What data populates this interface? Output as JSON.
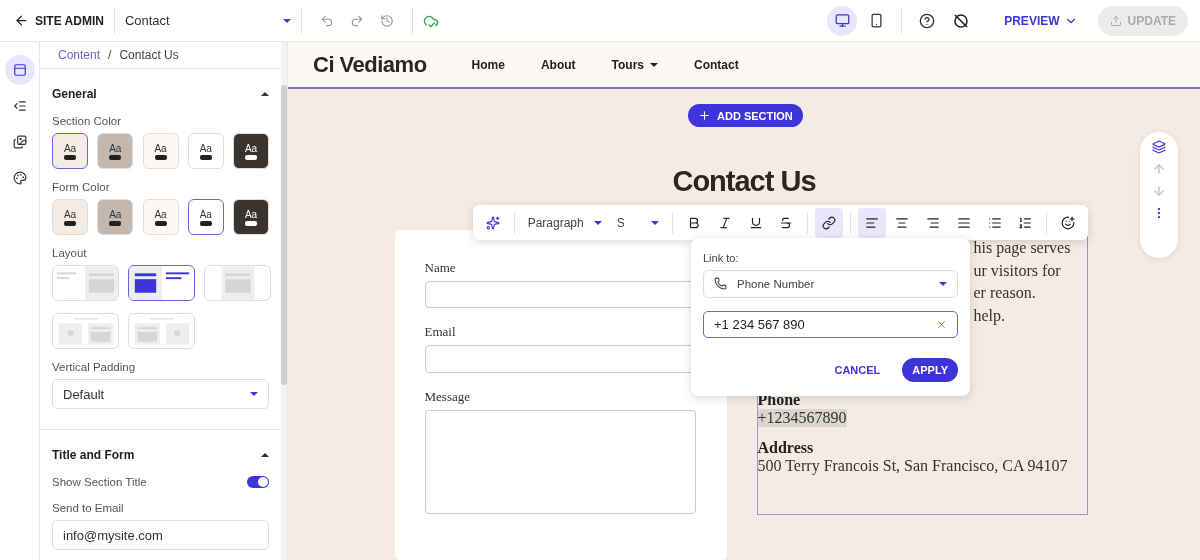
{
  "topbar": {
    "back_label": "SITE ADMIN",
    "page_select": "Contact",
    "devices": [
      {
        "kind": "desktop",
        "selected": true
      },
      {
        "kind": "mobile",
        "selected": false
      }
    ],
    "preview": "PREVIEW",
    "update": {
      "label": "UPDATE",
      "disabled": true
    }
  },
  "rail": [
    {
      "kind": "sections",
      "selected": true
    },
    {
      "kind": "navigator",
      "selected": false
    },
    {
      "kind": "pages",
      "selected": false
    },
    {
      "kind": "theme",
      "selected": false
    }
  ],
  "sidebar": {
    "breadcrumb": [
      "Content",
      "/",
      "Contact Us"
    ],
    "general": {
      "title": "General",
      "expanded": true,
      "section_color": {
        "label": "Section Color",
        "swatches": [
          {
            "label": "Aa",
            "color": "#f5ebe3",
            "selected": true
          },
          {
            "label": "Aa",
            "color": "#c4b8ae",
            "selected": false
          },
          {
            "label": "Aa",
            "color": "#fcf9f5",
            "selected": false
          },
          {
            "label": "Aa",
            "color": "#ffffff",
            "selected": false
          },
          {
            "label": "Aa",
            "color": "#3a332e",
            "selected": false
          }
        ]
      },
      "form_color": {
        "label": "Form Color",
        "swatches": [
          {
            "label": "Aa",
            "color": "#f5ebe3",
            "selected": false
          },
          {
            "label": "Aa",
            "color": "#c4b8ae",
            "selected": false
          },
          {
            "label": "Aa",
            "color": "#fcf9f5",
            "selected": false
          },
          {
            "label": "Aa",
            "color": "#ffffff",
            "selected": true
          },
          {
            "label": "Aa",
            "color": "#3a332e",
            "selected": false
          }
        ]
      },
      "layout": {
        "label": "Layout",
        "options": [
          {
            "kind": "text-image",
            "selected": false
          },
          {
            "kind": "image-text",
            "selected": true
          },
          {
            "kind": "image-center",
            "selected": false
          },
          {
            "kind": "map-image",
            "selected": false
          },
          {
            "kind": "image-map",
            "selected": false
          }
        ]
      },
      "vertical_padding": {
        "label": "Vertical Padding",
        "value": "Default"
      }
    },
    "title_and_form": {
      "title": "Title and Form",
      "expanded": true,
      "show_section_title": {
        "label": "Show Section Title",
        "on": true
      },
      "send_to_email": {
        "label": "Send to Email",
        "value": "info@mysite.com"
      }
    }
  },
  "canvas": {
    "logo": "Ci Vediamo",
    "nav": [
      {
        "label": "Home",
        "dropdown": false
      },
      {
        "label": "About",
        "dropdown": false
      },
      {
        "label": "Tours",
        "dropdown": true
      },
      {
        "label": "Contact",
        "dropdown": false
      }
    ],
    "add_section": "ADD SECTION",
    "title": "Contact Us",
    "form": {
      "fields": [
        {
          "label": "Name",
          "kind": "input"
        },
        {
          "label": "Email",
          "kind": "input"
        },
        {
          "label": "Message",
          "kind": "textarea"
        }
      ]
    },
    "info": {
      "intro_fragments": [
        "his page serves",
        "ur visitors for",
        "er reason.",
        "help."
      ],
      "phone": {
        "heading": "Phone",
        "value": "+1234567890",
        "selected": true
      },
      "address": {
        "heading": "Address",
        "value": "500 Terry Francois St, San Francisco, CA 94107"
      }
    }
  },
  "text_toolbar": {
    "block_type": "Paragraph",
    "size": "S",
    "buttons": [
      {
        "kind": "ai",
        "active": false
      },
      {
        "kind": "bold",
        "active": false
      },
      {
        "kind": "italic",
        "active": false
      },
      {
        "kind": "underline",
        "active": false
      },
      {
        "kind": "strike",
        "active": false
      },
      {
        "kind": "link",
        "active": true
      },
      {
        "kind": "align-left",
        "active": true
      },
      {
        "kind": "align-center",
        "active": false
      },
      {
        "kind": "align-right",
        "active": false
      },
      {
        "kind": "align-justify",
        "active": false
      },
      {
        "kind": "bullets",
        "active": false
      },
      {
        "kind": "numbers",
        "active": false
      },
      {
        "kind": "emoji",
        "active": false
      }
    ]
  },
  "link_popover": {
    "label": "Link to:",
    "type": "Phone Number",
    "value": "+1 234 567 890",
    "cancel": "CANCEL",
    "apply": "APPLY"
  }
}
